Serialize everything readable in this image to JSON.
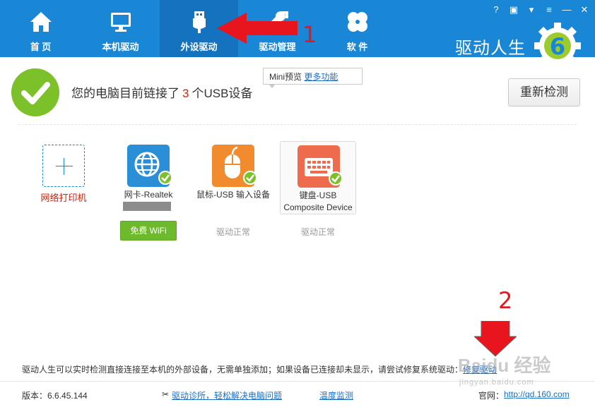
{
  "nav": {
    "items": [
      {
        "label": "首 页",
        "icon": "home-icon"
      },
      {
        "label": "本机驱动",
        "icon": "monitor-icon"
      },
      {
        "label": "外设驱动",
        "icon": "usb-plug-icon",
        "active": true
      },
      {
        "label": "驱动管理",
        "icon": "wrench-icon"
      },
      {
        "label": "软 件",
        "icon": "clover-icon"
      }
    ]
  },
  "window_controls": [
    "help-icon",
    "feedback-icon",
    "skin-icon",
    "menu-icon",
    "minimize-icon",
    "close-icon"
  ],
  "brand": {
    "name": "驱动人生",
    "logo_digit": "6"
  },
  "status": {
    "prefix": "您的电脑目前链接了",
    "count": "3",
    "suffix": "个USB设备"
  },
  "tooltip": {
    "text": "Mini预览",
    "link": "更多功能"
  },
  "recheck_label": "重新检测",
  "printer": {
    "label": "网络打印机"
  },
  "devices": [
    {
      "name_line1": "网卡-Realtek",
      "name_line2": "",
      "icon": "globe-icon",
      "color": "#2b8fd8",
      "action": "免费 WiFi"
    },
    {
      "name_line1": "鼠标-USB 输入设备",
      "name_line2": "",
      "icon": "mouse-icon",
      "color": "#f28a2e",
      "status": "驱动正常"
    },
    {
      "name_line1": "键盘-USB",
      "name_line2": "Composite Device",
      "icon": "keyboard-icon",
      "color": "#ee6b4d",
      "status": "驱动正常"
    }
  ],
  "annotations": {
    "one": "1",
    "two": "2"
  },
  "notice": {
    "text": "驱动人生可以实时检测直接连接至本机的外部设备，无需单独添加；如果设备已连接却未显示，请尝试修复系统驱动：",
    "link": "修复驱动"
  },
  "footer": {
    "version": "版本：6.6.45.144",
    "diagnose": "驱动诊所，轻松解决电脑问题",
    "temperature": "温度监测",
    "website_label": "官网：",
    "website": "http://qd.160.com"
  },
  "watermark": {
    "main": "Baidu 经验",
    "sub": "jingyan.baidu.com"
  },
  "colors": {
    "header": "#1a86d6",
    "active_tab": "#1572bf",
    "success": "#7cc02a",
    "accent_red": "#d81e06",
    "link": "#1a6fc8"
  }
}
